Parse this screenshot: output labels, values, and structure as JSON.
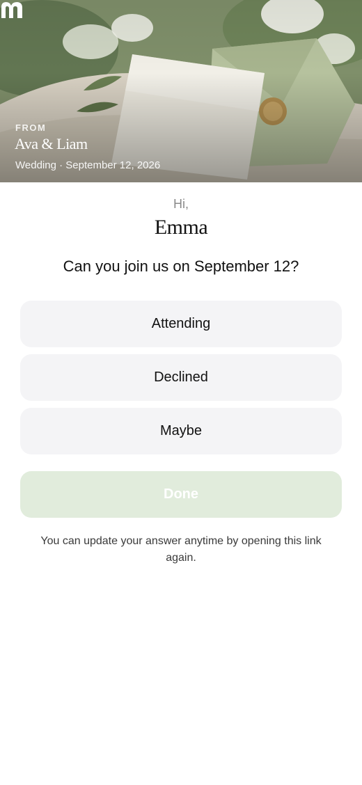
{
  "header": {
    "from_label": "FROM",
    "hosts": "Ava & Liam",
    "event_line": "Wedding · September 12, 2026"
  },
  "greeting": {
    "hi": "Hi,",
    "guest": "Emma"
  },
  "question": "Can you join us on September 12?",
  "options": [
    {
      "label": "Attending"
    },
    {
      "label": "Declined"
    },
    {
      "label": "Maybe"
    }
  ],
  "done_button": {
    "label": "Done",
    "enabled": false
  },
  "note": "You can update your answer anytime by opening this link again.",
  "colors": {
    "option_bg": "#f4f4f6",
    "done_bg_disabled": "#e1ecdc",
    "text_primary": "#111111",
    "text_muted": "#8a8a8a"
  }
}
